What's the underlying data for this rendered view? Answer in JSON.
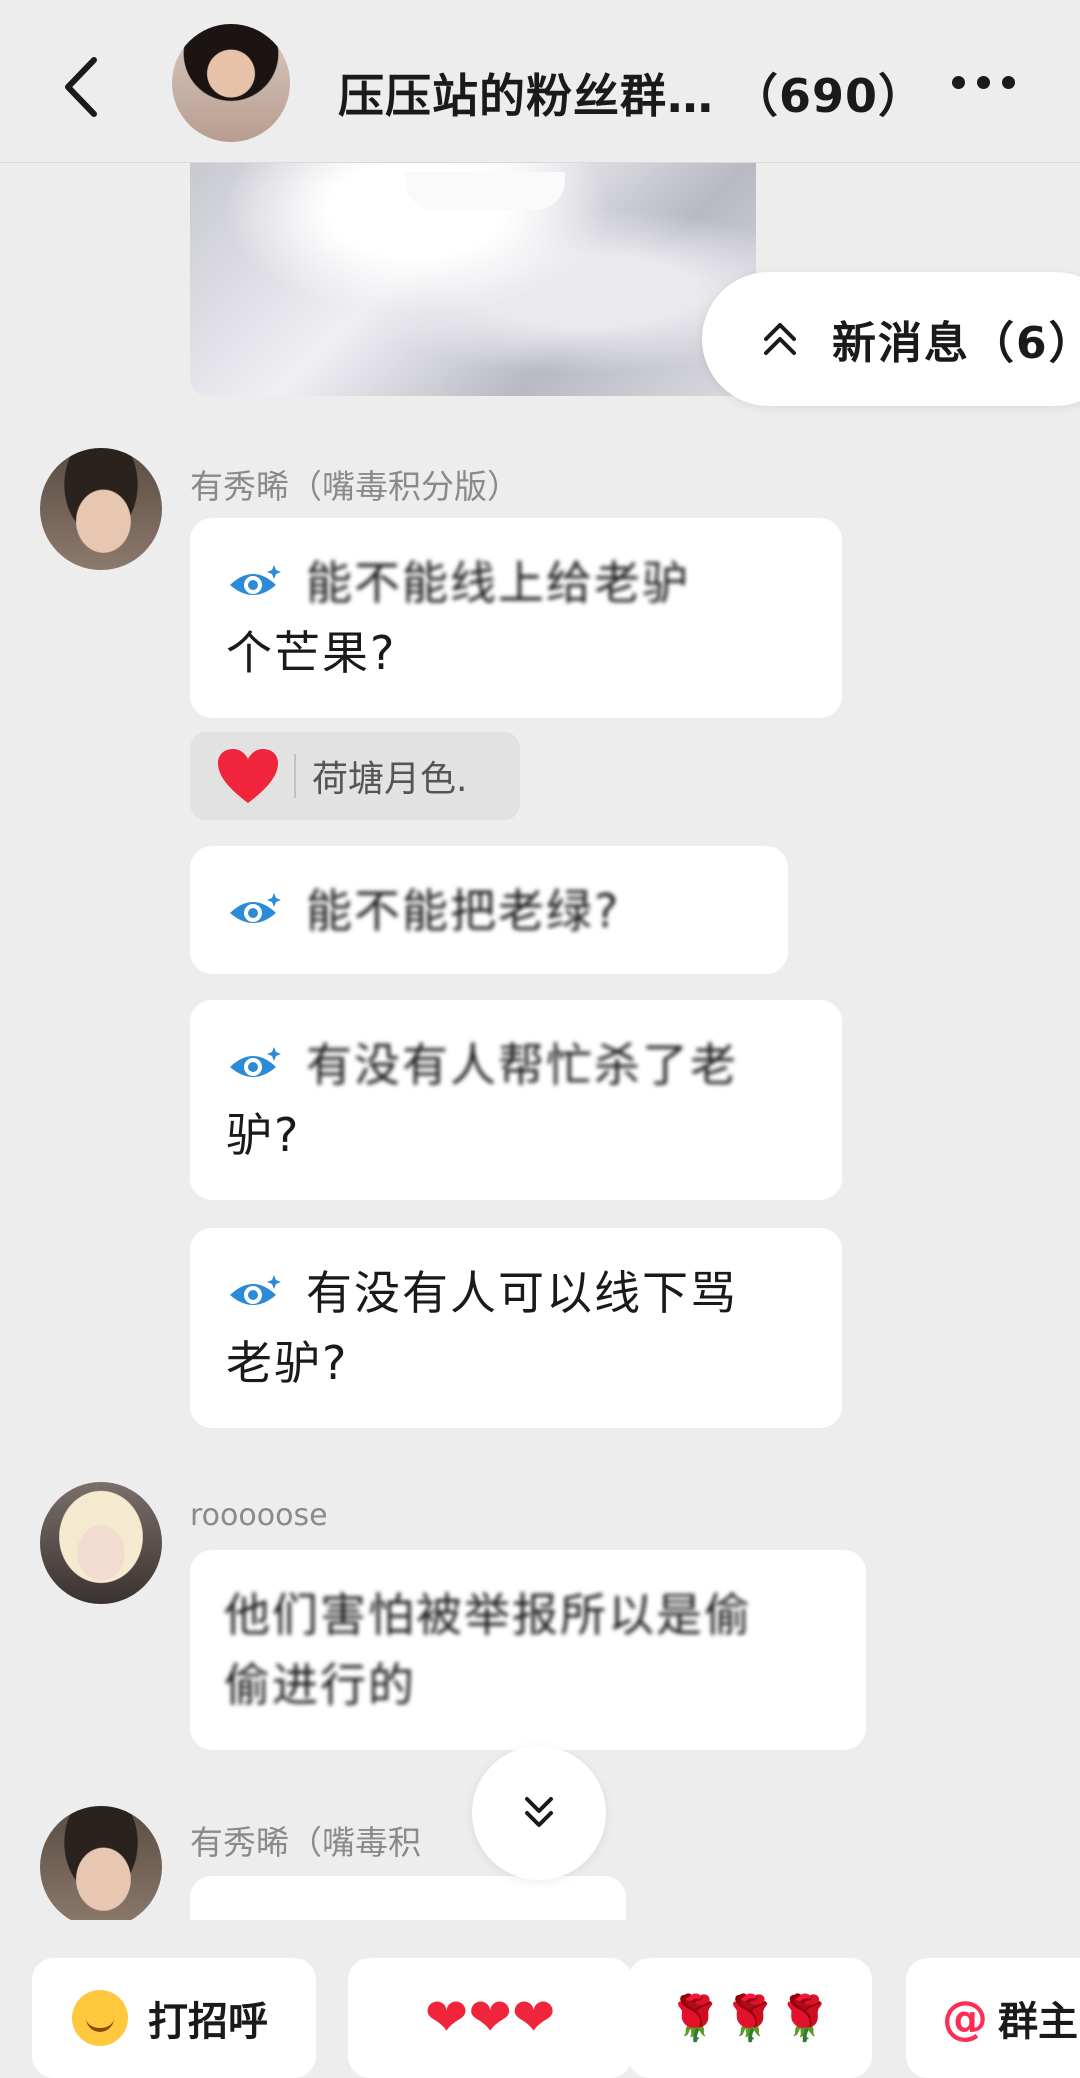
{
  "header": {
    "title": "压压站的粉丝群…",
    "member_count": "（690）"
  },
  "new_messages_pill": {
    "label": "新消息（6）"
  },
  "messages": [
    {
      "sender": "有秀晞（嘴毒积分版）",
      "bubbles": [
        {
          "line1": "能不能线上给老驴",
          "line2": "个芒果?"
        },
        {
          "line1": "能不能把老绿?"
        },
        {
          "line1": "有没有人帮忙杀了老",
          "line2": "驴?"
        },
        {
          "line1": "有没有人可以线下骂",
          "line2": "老驴?"
        }
      ],
      "reaction": {
        "name": "荷塘月色."
      }
    },
    {
      "sender": "rooooose",
      "bubbles": [
        {
          "line1": "他们害怕被举报所以是偷",
          "line2": "偷进行的"
        }
      ]
    },
    {
      "sender": "有秀晞（嘴毒积"
    }
  ],
  "quick_replies": [
    {
      "label": "打招呼"
    },
    {
      "label": "❤❤❤"
    },
    {
      "label": "🌹🌹🌹"
    },
    {
      "label": "群主"
    }
  ]
}
